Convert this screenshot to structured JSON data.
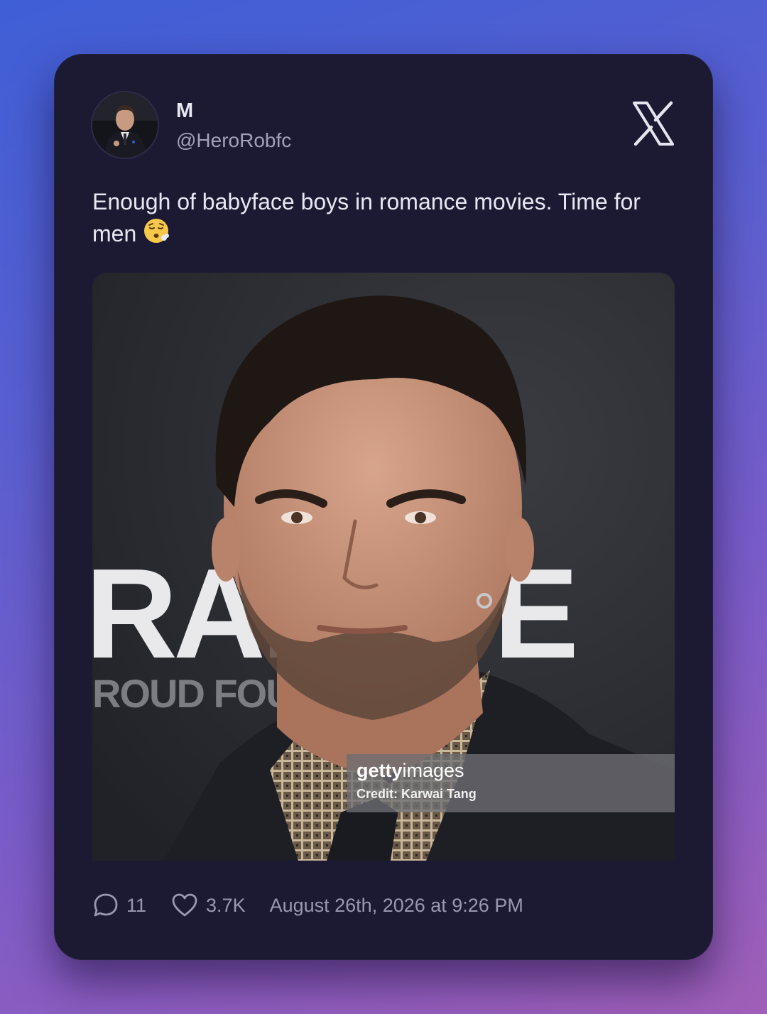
{
  "author": {
    "name": "M",
    "handle": "@HeroRobfc"
  },
  "platform_icon": "x-logo-icon",
  "tweet": {
    "text": "Enough of babyface boys in romance movies. Time for men",
    "emoji": "face-exhaling"
  },
  "media": {
    "watermark_brand_bold": "getty",
    "watermark_brand_light": "images",
    "watermark_credit": "Credit: Karwai Tang",
    "background_text_large": "RAI",
    "background_text_small": "ROUD FOU"
  },
  "stats": {
    "replies": "11",
    "likes": "3.7K",
    "timestamp": "August 26th, 2026 at 9:26 PM"
  },
  "colors": {
    "card_bg": "#1c1a33",
    "text_primary": "#e8e7f1",
    "text_secondary": "#a3a1b8"
  }
}
